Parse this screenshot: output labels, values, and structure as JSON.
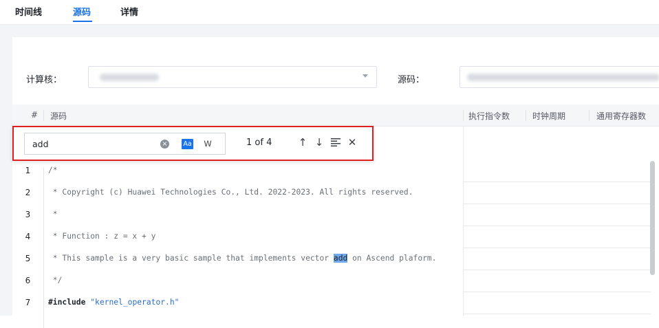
{
  "tabs": [
    {
      "label": "时间线",
      "active": false
    },
    {
      "label": "源码",
      "active": true
    },
    {
      "label": "详情",
      "active": false
    }
  ],
  "filters": {
    "kernel_label": "计算核：",
    "source_label": "源码："
  },
  "table": {
    "columns": [
      "#",
      "源码",
      "执行指令数",
      "时钟周期",
      "通用寄存器数"
    ]
  },
  "find": {
    "query": "add",
    "match_case_label": "Aa",
    "whole_word_label": "W",
    "result": "1 of 4",
    "accent_color": "#1a73e8",
    "highlight_box_color": "#e02020"
  },
  "code_lines": [
    {
      "num": "1",
      "text": "/*"
    },
    {
      "num": "2",
      "text": " * Copyright (c) Huawei Technologies Co., Ltd. 2022-2023. All rights reserved."
    },
    {
      "num": "3",
      "text": " *"
    },
    {
      "num": "4",
      "text": " * Function : z = x + y"
    },
    {
      "num": "5",
      "before": " * This sample is a very basic sample that implements vector ",
      "match": "add",
      "after": " on Ascend plaform."
    },
    {
      "num": "6",
      "text": " */"
    },
    {
      "num": "7",
      "keyword": "#include",
      "string": "\"kernel_operator.h\""
    }
  ]
}
